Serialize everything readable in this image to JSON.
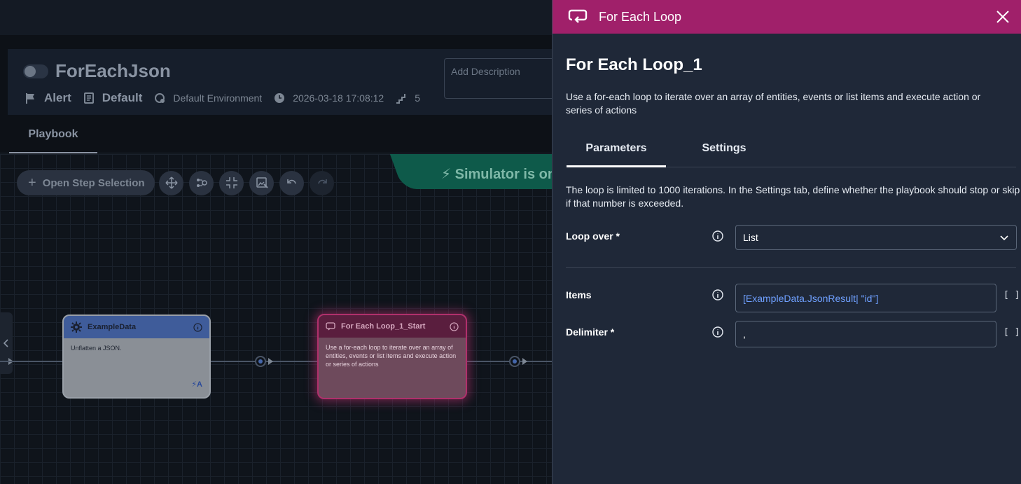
{
  "playbook": {
    "name": "ForEachJson",
    "alert_label": "Alert",
    "default_label": "Default",
    "environment": "Default Environment",
    "timestamp": "2026-03-18 17:08:12",
    "steps_count": "5",
    "description_placeholder": "Add Description"
  },
  "tabs": {
    "playbook": "Playbook"
  },
  "toolbar": {
    "open_step_selection": "Open Step Selection"
  },
  "simulator": {
    "text": "Simulator is on"
  },
  "nodes": [
    {
      "title": "ExampleData",
      "description": "Unflatten a JSON.",
      "badge": "A"
    },
    {
      "title": "For Each Loop_1_Start",
      "description": "Use a for-each loop to iterate over an array of entities, events or list items and execute action or series of actions"
    }
  ],
  "panel": {
    "header_title": "For Each Loop",
    "step_name": "For Each Loop_1",
    "description": "Use a for-each loop to iterate over an array of entities, events or list items and execute action or series of actions",
    "tabs": [
      {
        "label": "Parameters"
      },
      {
        "label": "Settings"
      }
    ],
    "limit_note": "The loop is limited to 1000 iterations. In the Settings tab, define whether the playbook should stop or skip if that number is exceeded.",
    "fields": {
      "loop_over": {
        "label": "Loop over *",
        "value": "List"
      },
      "items": {
        "label": "Items",
        "value": "[ExampleData.JsonResult| \"id\"]",
        "suffix": "[ ]"
      },
      "delimiter": {
        "label": "Delimiter *",
        "value": ",",
        "suffix": "[ ]"
      }
    }
  },
  "colors": {
    "panel_header": "#a0206a",
    "panel_bg": "#1f2838",
    "simulator": "#0e5a4a",
    "link": "#6fa0ff"
  }
}
